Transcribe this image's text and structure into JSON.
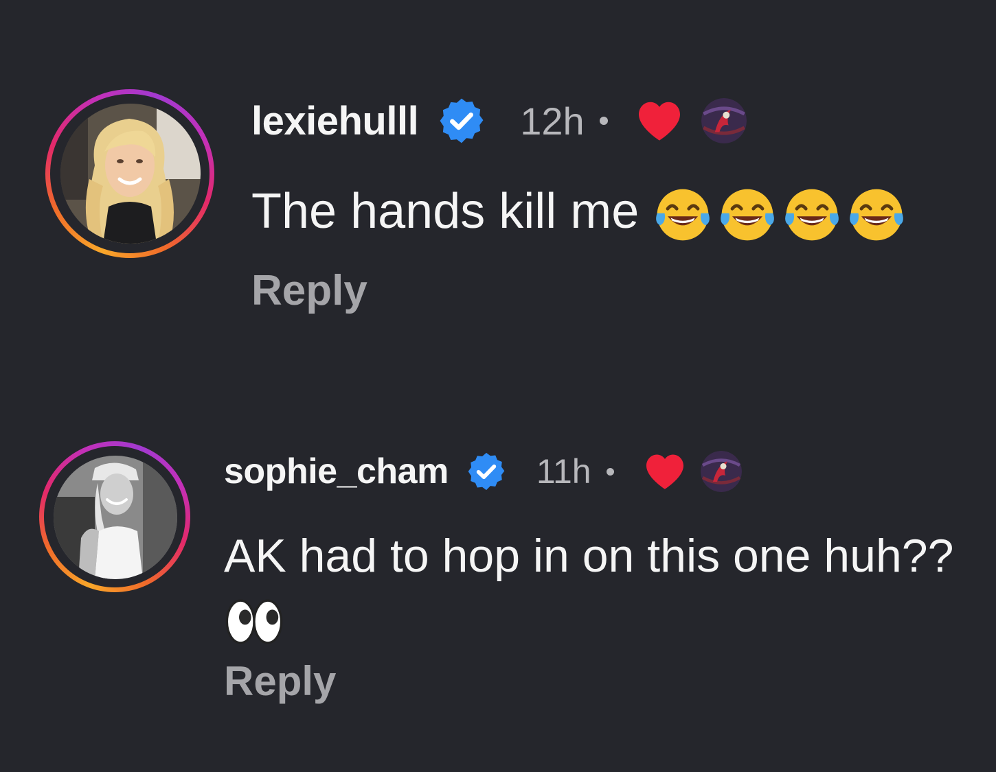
{
  "comments": [
    {
      "username": "lexiehulll",
      "time": "12h",
      "text": "The hands kill me",
      "emojis": [
        "face-with-tears-of-joy",
        "face-with-tears-of-joy",
        "face-with-tears-of-joy",
        "face-with-tears-of-joy"
      ],
      "reply_label": "Reply",
      "liked_by_author": true,
      "avatar_photo_style": "color"
    },
    {
      "username": "sophie_cham",
      "time": "11h",
      "text": "AK had to hop in on this one huh??",
      "emojis": [
        "eyes"
      ],
      "reply_label": "Reply",
      "liked_by_author": true,
      "avatar_photo_style": "black-and-white"
    }
  ],
  "colors": {
    "background": "#25262c",
    "verified": "#2f8cf5",
    "heart": "#f0213a",
    "reply": "#a5a5a9",
    "timestamp": "#b7b7bb"
  }
}
